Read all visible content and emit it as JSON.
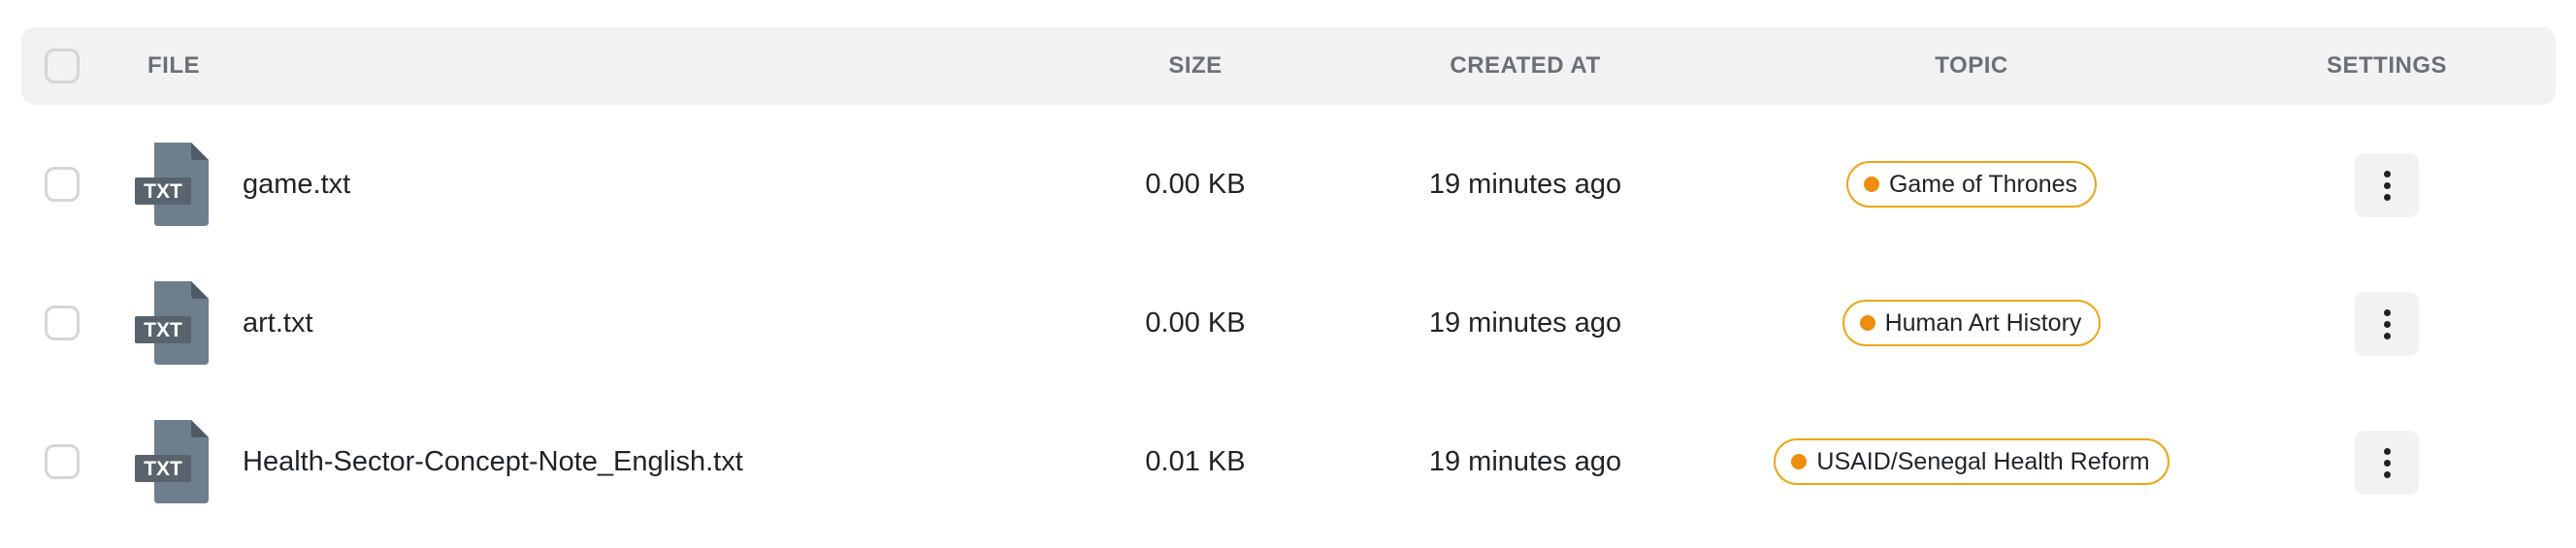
{
  "header": {
    "file": "FILE",
    "size": "SIZE",
    "created_at": "CREATED AT",
    "topic": "TOPIC",
    "settings": "SETTINGS"
  },
  "colors": {
    "header_bg": "#f2f2f2",
    "topic_border": "#efa514",
    "topic_dot": "#ef8d0c",
    "file_icon": "#6f7e8c"
  },
  "rows": [
    {
      "icon": "txt-file-icon",
      "icon_label": "TXT",
      "name": "game.txt",
      "size": "0.00 KB",
      "created_at": "19 minutes ago",
      "topic": "Game of Thrones"
    },
    {
      "icon": "txt-file-icon",
      "icon_label": "TXT",
      "name": "art.txt",
      "size": "0.00 KB",
      "created_at": "19 minutes ago",
      "topic": "Human Art History"
    },
    {
      "icon": "txt-file-icon",
      "icon_label": "TXT",
      "name": "Health-Sector-Concept-Note_English.txt",
      "size": "0.01 KB",
      "created_at": "19 minutes ago",
      "topic": "USAID/Senegal Health Reform"
    }
  ]
}
